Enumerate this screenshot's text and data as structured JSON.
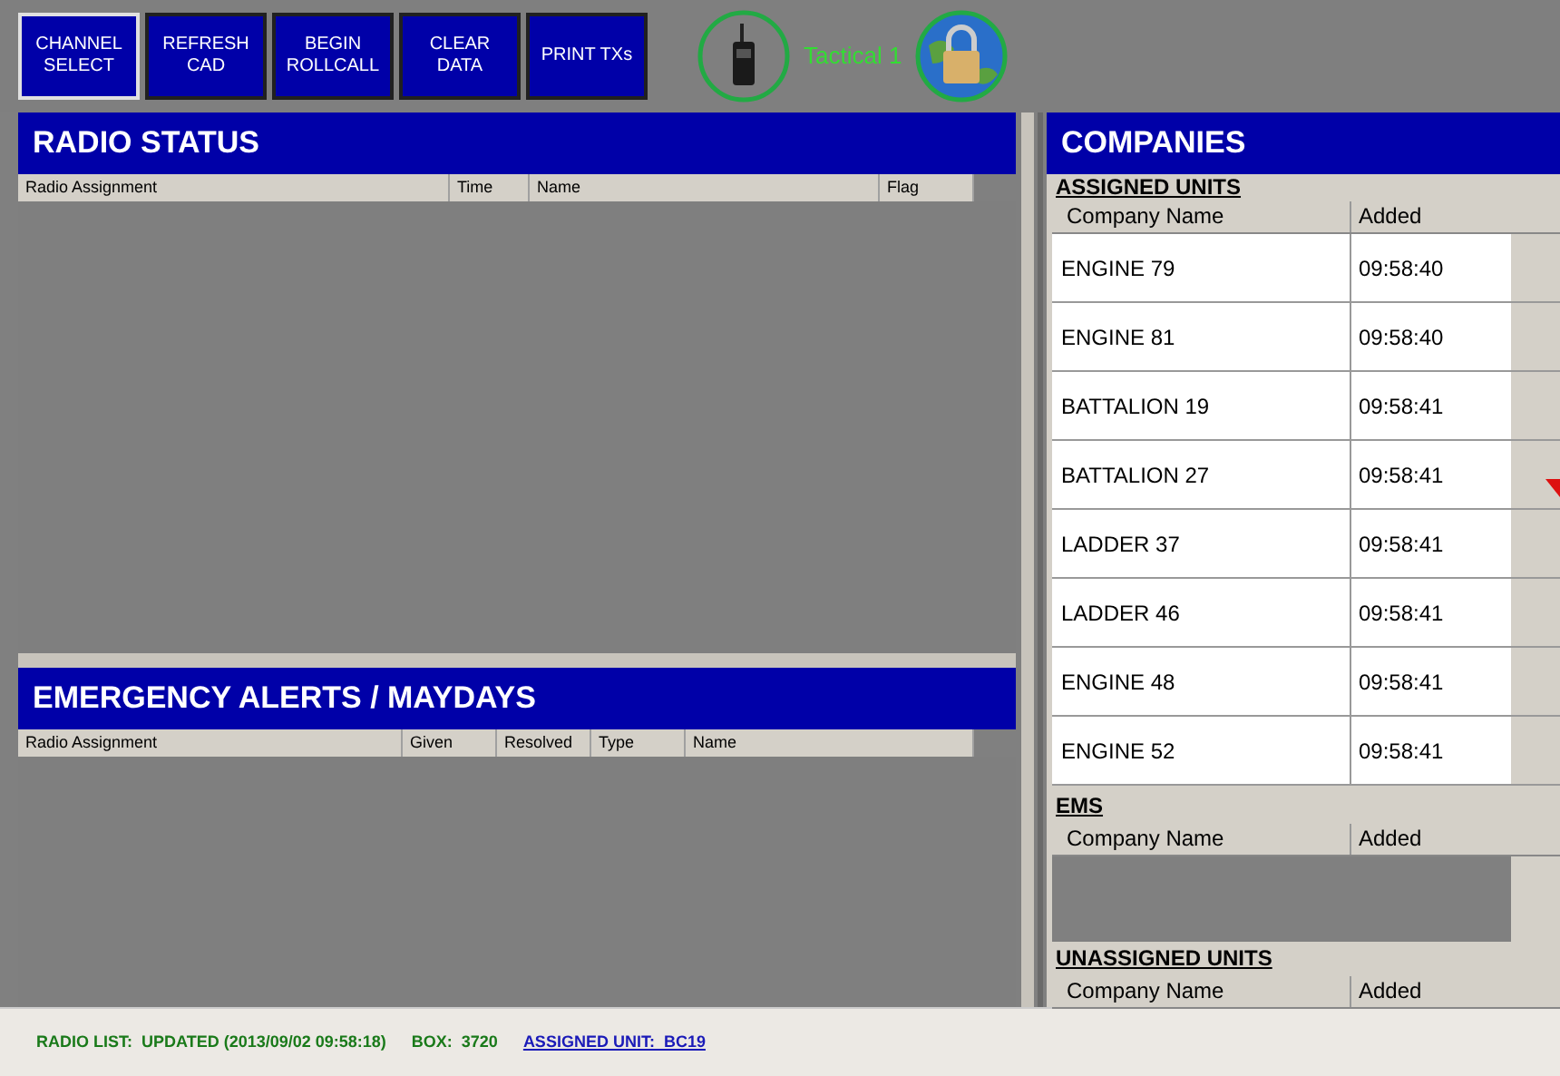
{
  "toolbar": {
    "buttons": [
      {
        "lines": [
          "CHANNEL",
          "SELECT"
        ],
        "selected": true
      },
      {
        "lines": [
          "REFRESH",
          "CAD"
        ],
        "selected": false
      },
      {
        "lines": [
          "BEGIN",
          "ROLLCALL"
        ],
        "selected": false
      },
      {
        "lines": [
          "CLEAR",
          "DATA"
        ],
        "selected": false
      },
      {
        "lines": [
          "PRINT TXs"
        ],
        "selected": false
      }
    ],
    "channel": "Tactical 1"
  },
  "radio_status": {
    "title": "RADIO STATUS",
    "columns": [
      "Radio Assignment",
      "Time",
      "Name",
      "Flag"
    ]
  },
  "emergency_alerts": {
    "title": "EMERGENCY ALERTS / MAYDAYS",
    "columns": [
      "Radio Assignment",
      "Given",
      "Resolved",
      "Type",
      "Name"
    ]
  },
  "companies": {
    "title": "COMPANIES",
    "assigned_units": {
      "label": "ASSIGNED UNITS",
      "columns": [
        "Company Name",
        "Added"
      ],
      "rows": [
        [
          "ENGINE 79",
          "09:58:40"
        ],
        [
          "ENGINE 81",
          "09:58:40"
        ],
        [
          "BATTALION 19",
          "09:58:41"
        ],
        [
          "BATTALION 27",
          "09:58:41"
        ],
        [
          "LADDER 37",
          "09:58:41"
        ],
        [
          "LADDER 46",
          "09:58:41"
        ],
        [
          "ENGINE 48",
          "09:58:41"
        ],
        [
          "ENGINE 52",
          "09:58:41"
        ]
      ]
    },
    "ems": {
      "label": "EMS",
      "columns": [
        "Company Name",
        "Added"
      ]
    },
    "unassigned_units": {
      "label": "UNASSIGNED UNITS",
      "columns": [
        "Company Name",
        "Added"
      ]
    }
  },
  "status_bar": {
    "radio_list": "RADIO LIST:  UPDATED (2013/09/02 09:58:18)",
    "box": "BOX:  3720",
    "assigned_unit": "ASSIGNED UNIT:  BC19"
  }
}
